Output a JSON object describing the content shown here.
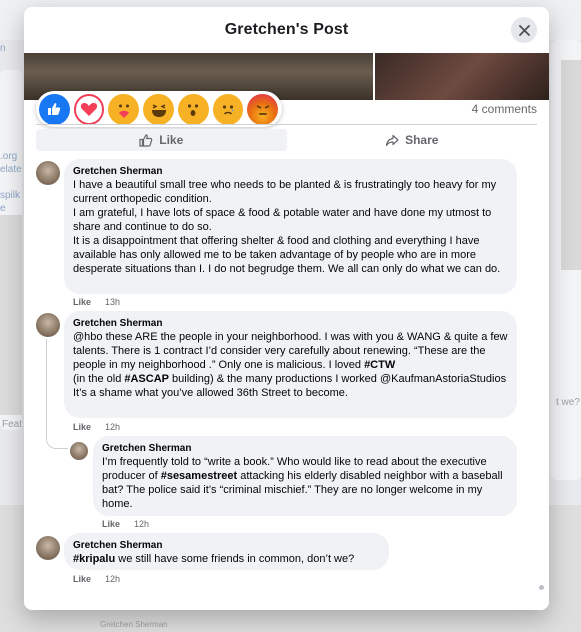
{
  "modal": {
    "title": "Gretchen's Post",
    "comments_count": "4 comments",
    "like_label": "Like",
    "share_label": "Share"
  },
  "reactions": [
    {
      "name": "like-reaction-icon",
      "color": "#1877f2"
    },
    {
      "name": "love-reaction-icon",
      "color": "#f33e58"
    },
    {
      "name": "care-reaction-icon",
      "color": "#f7b125"
    },
    {
      "name": "haha-reaction-icon",
      "color": "#f7b125"
    },
    {
      "name": "wow-reaction-icon",
      "color": "#f7b125"
    },
    {
      "name": "sad-reaction-icon",
      "color": "#f7b125"
    },
    {
      "name": "angry-reaction-icon",
      "color": "#e9710f"
    }
  ],
  "comments": [
    {
      "author": "Gretchen Sherman",
      "text": "I have a beautiful small tree who needs to be planted & is frustratingly too heavy for my current orthopedic condition.\nI am grateful, I have lots of space & food & potable water and have done my utmost to share and continue to do so.\nIt is a disappointment that offering shelter & food and clothing and everything I have available has only allowed me to be taken advantage of by people who are in more desperate situations than I. I do not begrudge them. We all can only do what we can do.",
      "like": "Like",
      "time": "13h"
    },
    {
      "author": "Gretchen Sherman",
      "text_a": "@hbo these ARE the people in your neighborhood. I was with you & WANG & quite a few talents. There is 1 contract I’d consider very carefully about renewing. “These are the people in my neighborhood .” Only one is malicious. I loved ",
      "tag_1": "#CTW",
      "text_b": "\n(in the old ",
      "tag_2": "#ASCAP",
      "text_c": " building) & the many productions I worked @KaufmanAstoriaStudios It’s a shame what you’ve allowed 36th Street to become.",
      "like": "Like",
      "time": "12h"
    },
    {
      "author": "Gretchen Sherman",
      "text_a": "I’m frequently told to “write a book.” Who would like to read about the executive producer of ",
      "tag_1": "#sesamestreet",
      "text_b": " attacking his elderly disabled neighbor with a baseball bat? The police said it’s “criminal mischief.” They are no longer welcome in my home.",
      "like": "Like",
      "time": "12h"
    },
    {
      "author": "Gretchen Sherman",
      "tag_1": "#kripalu",
      "text_a": " we still have some friends in common, don’t we?",
      "like": "Like",
      "time": "12h"
    }
  ],
  "background": {
    "link_fragments": [
      "n",
      ".org",
      "elate",
      "spilk",
      "e"
    ],
    "right_fragment": "t we?",
    "left_fragment": "Feat",
    "bottom_fragment": "Gretchen Sherman"
  }
}
